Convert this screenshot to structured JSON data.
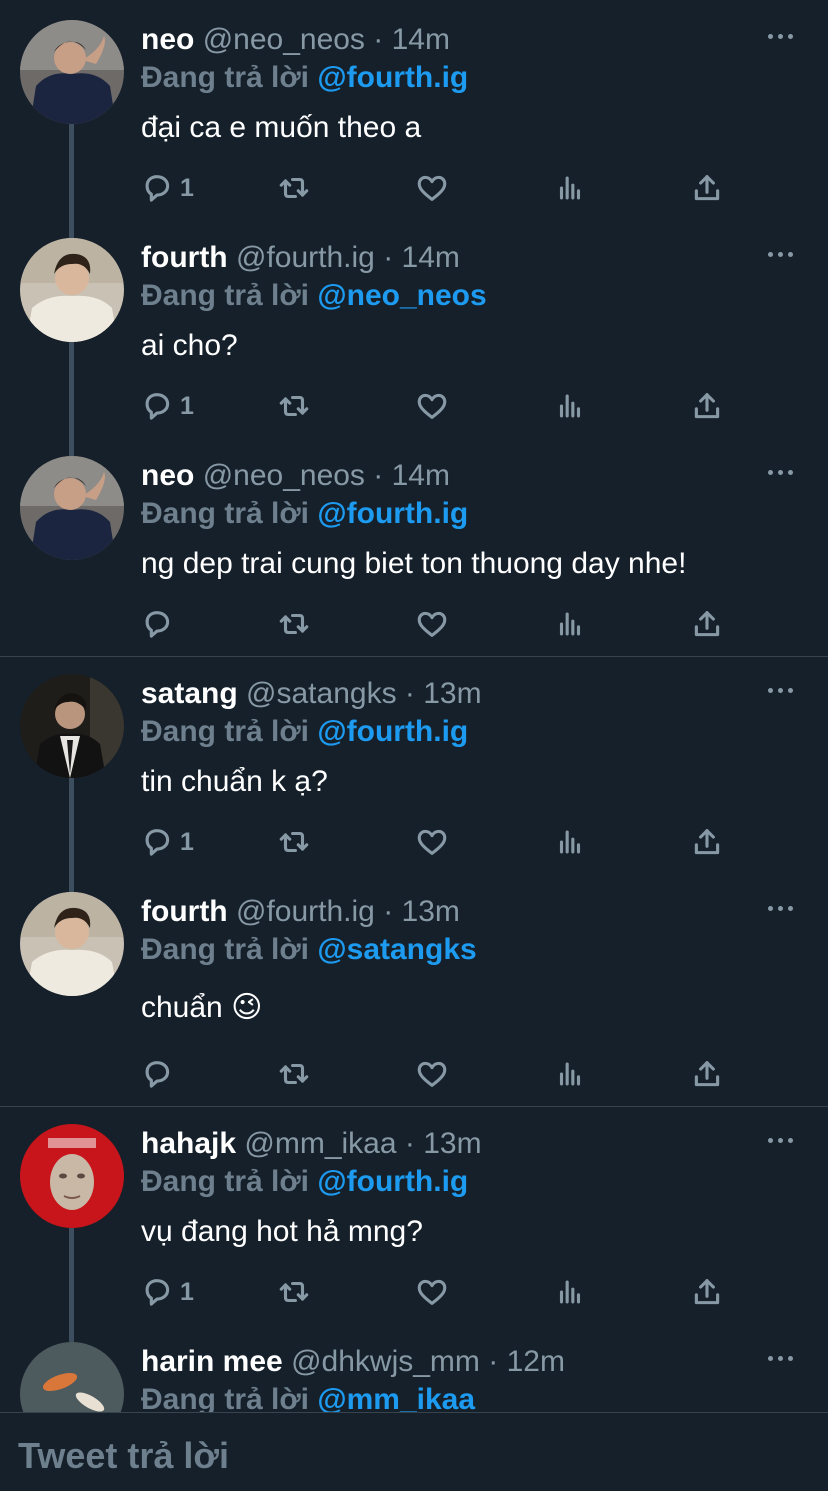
{
  "colors": {
    "background": "#15202b",
    "accent": "#1d9bf0",
    "muted": "#8899a6"
  },
  "tweets": [
    {
      "name": "neo",
      "handle": "@neo_neos",
      "time": "· 14m",
      "reply_prefix": "Đang trả lời",
      "reply_to": "@fourth.ig",
      "text": "đại ca e muốn theo a",
      "reply_count": "1",
      "avatar_alt": "neo profile photo"
    },
    {
      "name": "fourth",
      "handle": "@fourth.ig",
      "time": "· 14m",
      "reply_prefix": "Đang trả lời",
      "reply_to": "@neo_neos",
      "text": "ai cho?",
      "reply_count": "1",
      "avatar_alt": "fourth profile photo"
    },
    {
      "name": "neo",
      "handle": "@neo_neos",
      "time": "· 14m",
      "reply_prefix": "Đang trả lời",
      "reply_to": "@fourth.ig",
      "text": "ng dep trai cung biet ton thuong day nhe!",
      "reply_count": "",
      "avatar_alt": "neo profile photo"
    },
    {
      "name": "satang",
      "handle": "@satangks",
      "time": "· 13m",
      "reply_prefix": "Đang trả lời",
      "reply_to": "@fourth.ig",
      "text": "tin chuẩn k ạ?",
      "reply_count": "1",
      "avatar_alt": "satang profile photo"
    },
    {
      "name": "fourth",
      "handle": "@fourth.ig",
      "time": "· 13m",
      "reply_prefix": "Đang trả lời",
      "reply_to": "@satangks",
      "text": "chuẩn 😉",
      "reply_count": "",
      "avatar_alt": "fourth profile photo"
    },
    {
      "name": "hahajk",
      "handle": "@mm_ikaa",
      "time": "· 13m",
      "reply_prefix": "Đang trả lời",
      "reply_to": "@fourth.ig",
      "text": "vụ đang hot hả mng?",
      "reply_count": "1",
      "avatar_alt": "hahajk profile photo"
    },
    {
      "name": "harin mee",
      "handle": "@dhkwjs_mm",
      "time": "· 12m",
      "reply_prefix": "Đang trả lời",
      "reply_to": "@mm_ikaa",
      "text": "",
      "reply_count": "",
      "avatar_alt": "harin mee profile photo"
    }
  ],
  "composer": {
    "placeholder": "Tweet trả lời"
  }
}
